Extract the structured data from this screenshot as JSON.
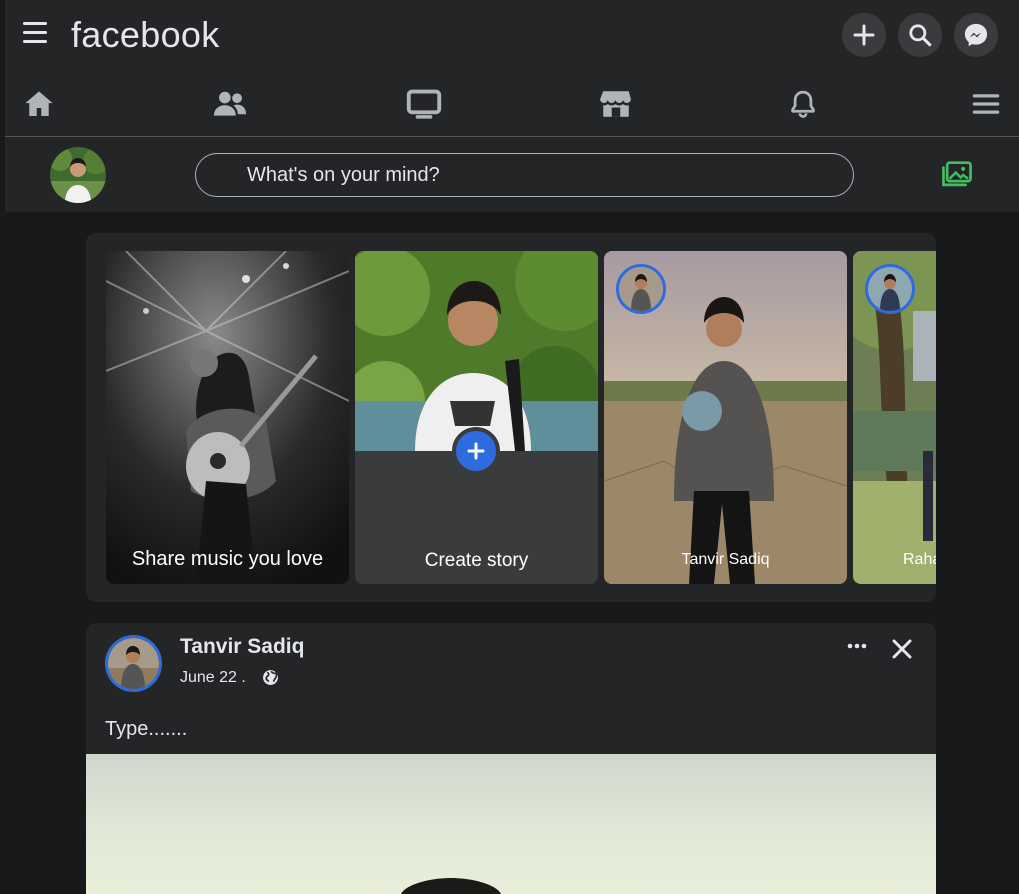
{
  "header": {
    "logo": "facebook",
    "icons": [
      "menu-icon",
      "plus-icon",
      "search-icon",
      "messenger-icon"
    ]
  },
  "nav": {
    "items": [
      "home-icon",
      "friends-icon",
      "watch-icon",
      "marketplace-icon",
      "notifications-icon",
      "menu-lines-icon"
    ]
  },
  "composer": {
    "placeholder": "What's on your mind?"
  },
  "stories": [
    {
      "label": "Share music you love"
    },
    {
      "label": "Create story"
    },
    {
      "label": "Tanvir Sadiq"
    },
    {
      "label": "Raha"
    }
  ],
  "post": {
    "author": "Tanvir Sadiq",
    "date": "June 22 .",
    "text": "Type......."
  },
  "colors": {
    "accent": "#2d6cdf",
    "photo_green": "#45bd62",
    "surface": "#242526",
    "background": "#18191a"
  }
}
